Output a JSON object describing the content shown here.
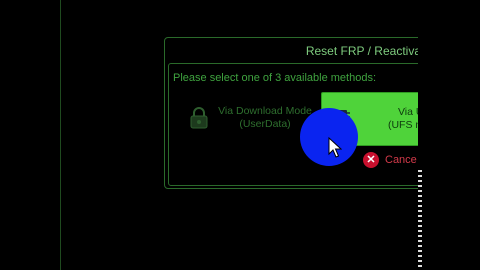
{
  "dialog": {
    "title": "Reset FRP / Reactiva",
    "prompt": "Please select one of 3 available methods:",
    "methods": [
      {
        "line1": "Via Download Mode",
        "line2": "(UserData)",
        "icon": "lock-icon"
      },
      {
        "line1": "Via UAR",
        "line2": "(UFS memor",
        "icon": "chip-icon",
        "selected": true
      }
    ],
    "cancel_label": "Cance"
  },
  "colors": {
    "accent": "#4fd33a",
    "text_green": "#3fa33f",
    "cancel_red": "#c8102e",
    "cursor_highlight": "#0a24f0"
  }
}
